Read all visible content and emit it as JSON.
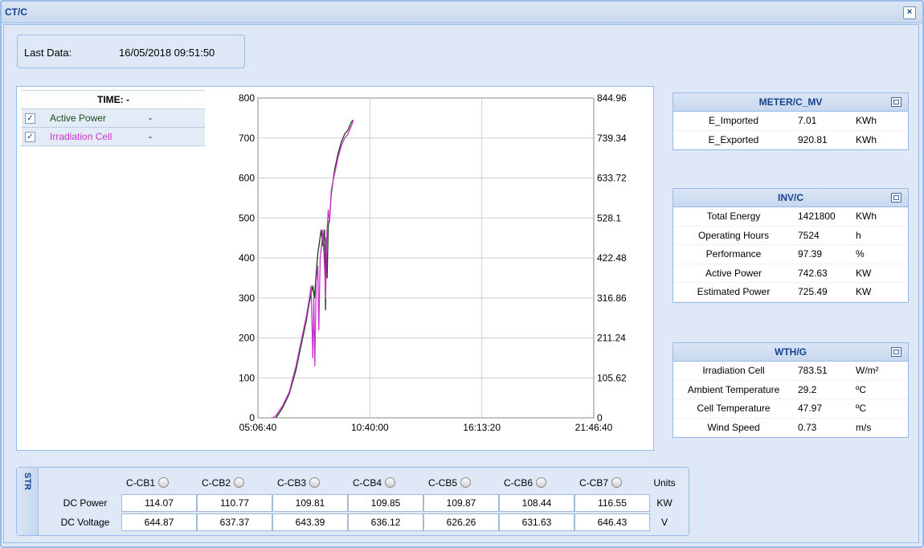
{
  "window": {
    "title": "CT/C",
    "close_label": "×"
  },
  "last_data": {
    "label": "Last Data:",
    "value": "16/05/2018 09:51:50"
  },
  "legend": {
    "time_label": "TIME:",
    "time_value": "-",
    "items": [
      {
        "label": "Active Power",
        "value": "-",
        "checked": true,
        "color": "#1a4d1a"
      },
      {
        "label": "Irradiation Cell",
        "value": "-",
        "checked": true,
        "color": "#cc33cc"
      }
    ]
  },
  "chart_data": {
    "type": "line",
    "x_ticks": [
      "05:06:40",
      "10:40:00",
      "16:13:20",
      "21:46:40"
    ],
    "x_range": [
      "05:06:40",
      "21:46:40"
    ],
    "y_left_ticks": [
      "0",
      "100",
      "200",
      "300",
      "400",
      "500",
      "600",
      "700",
      "800"
    ],
    "y_left_range": [
      0,
      800
    ],
    "y_right_ticks": [
      "0",
      "105.62",
      "211.24",
      "316.86",
      "422.48",
      "528.1",
      "633.72",
      "739.34",
      "844.96"
    ],
    "y_right_range": [
      0,
      844.96
    ],
    "grid": true,
    "series": [
      {
        "name": "Active Power",
        "axis": "left",
        "color": "#1a3d1a",
        "x": [
          "06:00",
          "06:10",
          "06:20",
          "06:40",
          "07:00",
          "07:20",
          "07:30",
          "07:40",
          "07:45",
          "07:50",
          "07:55",
          "08:00",
          "08:05",
          "08:10",
          "08:15",
          "08:20",
          "08:25",
          "08:28",
          "08:30",
          "08:33",
          "08:36",
          "08:40",
          "08:45",
          "08:55",
          "09:05",
          "09:15",
          "09:25",
          "09:35",
          "09:45",
          "09:51"
        ],
        "y": [
          0,
          12,
          25,
          60,
          120,
          200,
          240,
          290,
          310,
          330,
          300,
          360,
          410,
          440,
          470,
          430,
          470,
          270,
          450,
          350,
          480,
          500,
          560,
          620,
          660,
          690,
          710,
          720,
          740,
          745
        ]
      },
      {
        "name": "Irradiation Cell",
        "axis": "left",
        "color": "#cc33cc",
        "x": [
          "05:50",
          "06:00",
          "06:10",
          "06:20",
          "06:40",
          "07:00",
          "07:20",
          "07:30",
          "07:40",
          "07:45",
          "07:50",
          "07:53",
          "07:56",
          "08:00",
          "08:05",
          "08:08",
          "08:12",
          "08:15",
          "08:20",
          "08:25",
          "08:28",
          "08:32",
          "08:36",
          "08:40",
          "08:45",
          "08:55",
          "09:05",
          "09:15",
          "09:25",
          "09:35",
          "09:45",
          "09:51"
        ],
        "y": [
          0,
          5,
          18,
          30,
          65,
          130,
          210,
          250,
          300,
          330,
          150,
          300,
          130,
          340,
          380,
          220,
          400,
          420,
          470,
          380,
          300,
          460,
          520,
          490,
          570,
          610,
          650,
          680,
          700,
          710,
          730,
          745
        ]
      }
    ]
  },
  "panels": [
    {
      "title": "METER/C_MV",
      "rows": [
        {
          "name": "E_Imported",
          "value": "7.01",
          "unit": "KWh"
        },
        {
          "name": "E_Exported",
          "value": "920.81",
          "unit": "KWh"
        }
      ]
    },
    {
      "title": "INV/C",
      "rows": [
        {
          "name": "Total Energy",
          "value": "1421800",
          "unit": "KWh"
        },
        {
          "name": "Operating Hours",
          "value": "7524",
          "unit": "h"
        },
        {
          "name": "Performance",
          "value": "97.39",
          "unit": "%"
        },
        {
          "name": "Active Power",
          "value": "742.63",
          "unit": "KW"
        },
        {
          "name": "Estimated Power",
          "value": "725.49",
          "unit": "KW"
        }
      ]
    },
    {
      "title": "WTH/G",
      "rows": [
        {
          "name": "Irradiation Cell",
          "value": "783.51",
          "unit": "W/m²"
        },
        {
          "name": "Ambient Temperature",
          "value": "29.2",
          "unit": "ºC"
        },
        {
          "name": "Cell Temperature",
          "value": "47.97",
          "unit": "ºC"
        },
        {
          "name": "Wind Speed",
          "value": "0.73",
          "unit": "m/s"
        }
      ]
    }
  ],
  "str": {
    "tab_label": "STR",
    "units_header": "Units",
    "combiners": [
      "C-CB1",
      "C-CB2",
      "C-CB3",
      "C-CB4",
      "C-CB5",
      "C-CB6",
      "C-CB7"
    ],
    "rows": [
      {
        "label": "DC Power",
        "values": [
          "114.07",
          "110.77",
          "109.81",
          "109.85",
          "109.87",
          "108.44",
          "116.55"
        ],
        "unit": "KW"
      },
      {
        "label": "DC Voltage",
        "values": [
          "644.87",
          "637.37",
          "643.39",
          "636.12",
          "626.26",
          "631.63",
          "646.43"
        ],
        "unit": "V"
      }
    ]
  }
}
